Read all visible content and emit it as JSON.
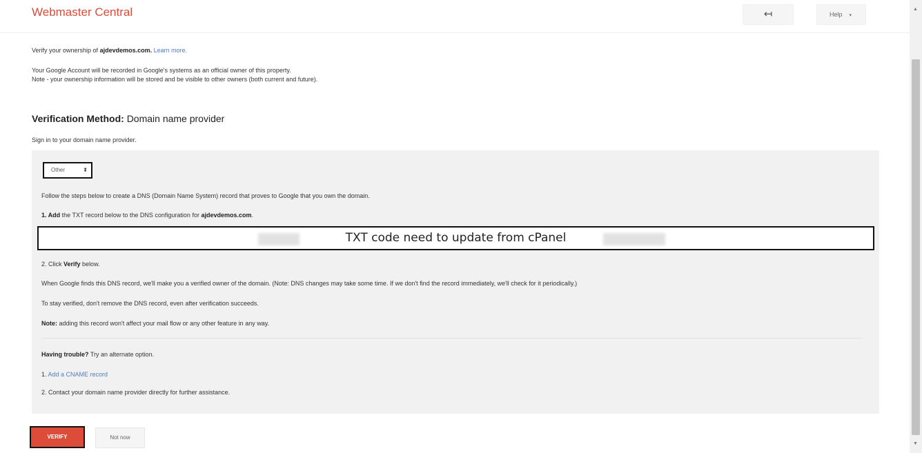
{
  "header": {
    "title": "Webmaster Central",
    "back_icon": "↤",
    "help_label": "Help",
    "help_caret": "▾"
  },
  "intro": {
    "verify_prefix": "Verify your ownership of ",
    "domain": "ajdevdemos.com.",
    "learn_more": "Learn more.",
    "line1": "Your Google Account will be recorded in Google's systems as an official owner of this property.",
    "line2": "Note - your ownership information will be stored and be visible to other owners (both current and future)."
  },
  "method": {
    "label": "Verification Method:",
    "value": "Domain name provider",
    "signin": "Sign in to your domain name provider."
  },
  "panel": {
    "provider_selected": "Other",
    "follow_steps": "Follow the steps below to create a DNS (Domain Name System) record that proves to Google that you own the domain.",
    "step1_bold": "1. Add",
    "step1_mid": " the TXT record below to the DNS configuration for ",
    "step1_domain": "ajdevdemos.com",
    "step1_end": ".",
    "txt_code": "TXT code need to update from cPanel",
    "step2_pre": "2. Click ",
    "step2_bold": "Verify",
    "step2_post": " below.",
    "when_found": "When Google finds this DNS record, we'll make you a verified owner of the domain. (Note: DNS changes may take some time. If we don't find the record immediately, we'll check for it periodically.)",
    "stay_verified": "To stay verified, don't remove the DNS record, even after verification succeeds.",
    "note_bold": "Note:",
    "note_text": " adding this record won't affect your mail flow or any other feature in any way.",
    "trouble_bold": "Having trouble?",
    "trouble_text": " Try an alternate option.",
    "alt1_num": "1. ",
    "alt1_link": "Add a CNAME record",
    "alt2": "2. Contact your domain name provider directly for further assistance."
  },
  "actions": {
    "verify": "VERIFY",
    "not_now": "Not now"
  }
}
